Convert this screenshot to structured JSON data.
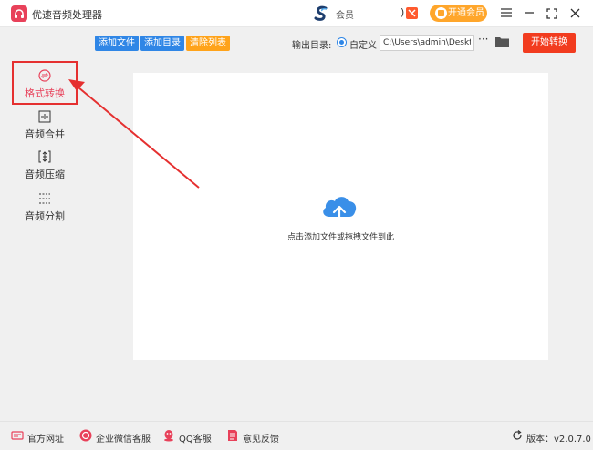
{
  "app": {
    "title": "优速音频处理器"
  },
  "membership": {
    "label": "会员",
    "paren": ")",
    "vip_button": "开通会员"
  },
  "sidebar": {
    "items": [
      {
        "label": "格式转换",
        "icon": "format-convert-icon"
      },
      {
        "label": "音频合并",
        "icon": "audio-merge-icon"
      },
      {
        "label": "音频压缩",
        "icon": "audio-compress-icon"
      },
      {
        "label": "音频分割",
        "icon": "audio-split-icon"
      }
    ]
  },
  "toolbar": {
    "add_file": "添加文件",
    "add_folder": "添加目录",
    "clear_list": "清除列表",
    "output_label": "输出目录:",
    "custom_option": "自定义",
    "output_path": "C:\\Users\\admin\\Deskto",
    "more": "···",
    "start_button": "开始转换"
  },
  "drop_area": {
    "hint": "点击添加文件或拖拽文件到此"
  },
  "statusbar": {
    "website": "官方网址",
    "wechat": "企业微信客服",
    "qq": "QQ客服",
    "feedback": "意见反馈",
    "version": "版本：v2.0.7.0"
  },
  "colors": {
    "accent_red": "#e8415a",
    "primary_blue": "#2f86e6",
    "orange": "#ffa31a",
    "start_red": "#f23c1f",
    "annotation_red": "#e53030"
  }
}
